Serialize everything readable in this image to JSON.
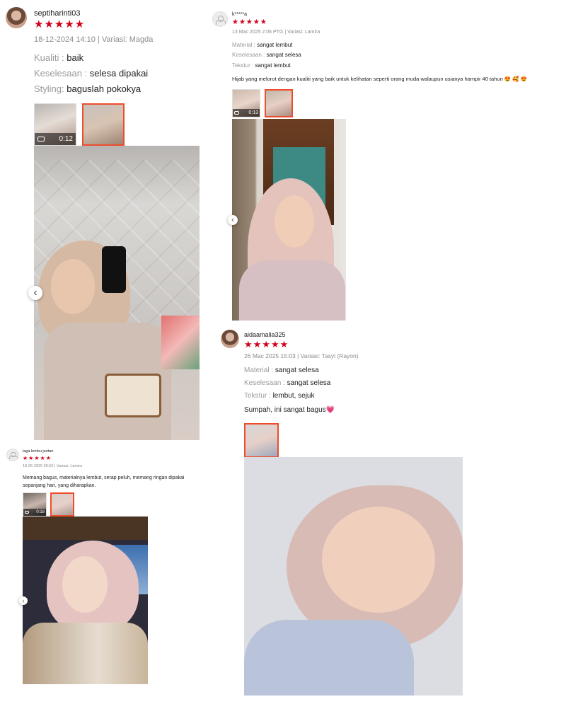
{
  "stars": "★★★★★",
  "reviews": [
    {
      "username": "septiharinti03",
      "meta": "18-12-2024 14:10 | Variasi: Magda",
      "attrs": [
        {
          "key": "Kualiti",
          "value": "baik"
        },
        {
          "key": "Keselesaan",
          "value": "selesa dipakai"
        },
        {
          "key": "Styling",
          "value": "baguslah pokokya"
        }
      ],
      "video_duration": "0:12"
    },
    {
      "username": "k*****a",
      "meta": "13 Mac 2025 2:06 PTG | Variasi: Lamira",
      "attrs": [
        {
          "key": "Material",
          "value": "sangat lembut"
        },
        {
          "key": "Keselesaan",
          "value": "sangat selesa"
        },
        {
          "key": "Tekstur",
          "value": "sangat lembut"
        }
      ],
      "comment": "Hijab yang melorot dengan kualiti yang baik untuk kelihatan seperti orang muda walaupun usianya hampir 40 tahun 😍 🥰 😍",
      "video_duration": "0:13"
    },
    {
      "username": "aidaamalia325",
      "meta": "26 Mac 2025 15:03 | Variasi: Tasyi (Rayon)",
      "attrs": [
        {
          "key": "Material",
          "value": "sangat selesa"
        },
        {
          "key": "Keselesaan",
          "value": "sangat selesa"
        },
        {
          "key": "Tekstur",
          "value": "lembut, sejuk"
        }
      ],
      "comment": "Sumpah, ini sangat bagus💗"
    },
    {
      "username": "laga lembu jantan",
      "meta": "18-05-2025 09:59 | Variasi: Lamira",
      "comment": "Memang bagus, materialnya lembut, serap peluh, memang ringan dipakai sepanjang hari, yang diharapkan.",
      "video_duration": "0:18"
    }
  ],
  "nav_prev": "‹",
  "colors": {
    "star": "#d0011b",
    "selected_border": "#ee4d2d",
    "meta": "#8a8a8a",
    "label": "#9a9a9a"
  }
}
